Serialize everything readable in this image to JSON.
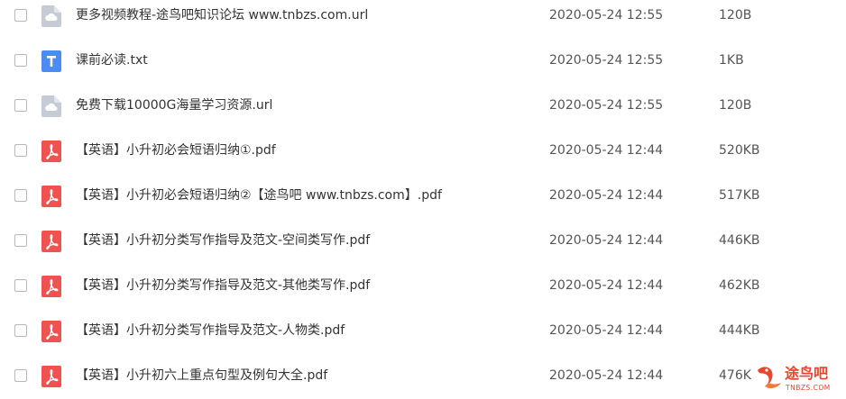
{
  "files": [
    {
      "type": "url",
      "icon": "url-file-icon",
      "name": "更多视频教程-途鸟吧知识论坛 www.tnbzs.com.url",
      "date": "2020-05-24 12:55",
      "size": "120B"
    },
    {
      "type": "txt",
      "icon": "txt-file-icon",
      "name": "课前必读.txt",
      "date": "2020-05-24 12:55",
      "size": "1KB"
    },
    {
      "type": "url",
      "icon": "url-file-icon",
      "name": "免费下载10000G海量学习资源.url",
      "date": "2020-05-24 12:55",
      "size": "120B"
    },
    {
      "type": "pdf",
      "icon": "pdf-file-icon",
      "name": "【英语】小升初必会短语归纳①.pdf",
      "date": "2020-05-24 12:44",
      "size": "520KB"
    },
    {
      "type": "pdf",
      "icon": "pdf-file-icon",
      "name": "【英语】小升初必会短语归纳②【途鸟吧 www.tnbzs.com】.pdf",
      "date": "2020-05-24 12:44",
      "size": "517KB"
    },
    {
      "type": "pdf",
      "icon": "pdf-file-icon",
      "name": "【英语】小升初分类写作指导及范文-空间类写作.pdf",
      "date": "2020-05-24 12:44",
      "size": "446KB"
    },
    {
      "type": "pdf",
      "icon": "pdf-file-icon",
      "name": "【英语】小升初分类写作指导及范文-其他类写作.pdf",
      "date": "2020-05-24 12:44",
      "size": "462KB"
    },
    {
      "type": "pdf",
      "icon": "pdf-file-icon",
      "name": "【英语】小升初分类写作指导及范文-人物类.pdf",
      "date": "2020-05-24 12:44",
      "size": "444KB"
    },
    {
      "type": "pdf",
      "icon": "pdf-file-icon",
      "name": "【英语】小升初六上重点句型及例句大全.pdf",
      "date": "2020-05-24 12:44",
      "size": "476K"
    }
  ],
  "watermark": {
    "brand": "途鸟吧",
    "domain": "TNBZS.COM",
    "icon": "bird-logo-icon"
  },
  "colors": {
    "pdf": "#f0524f",
    "txt": "#4b8cf0",
    "url": "#c6ccd6",
    "watermark": "#e8462c"
  }
}
